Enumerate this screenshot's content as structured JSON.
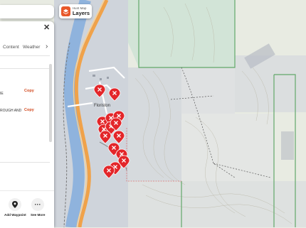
{
  "header": {
    "layers_sublabel": "Hunt Map",
    "layers_label": "Layers"
  },
  "panel": {
    "tabs": [
      "Content",
      "Weather"
    ],
    "rows": [
      {
        "text": "IE",
        "copy": "Copy"
      },
      {
        "text": "ROUGH AND",
        "copy": "Copy"
      }
    ],
    "actions": {
      "add_waypoint": "Add Waypoint",
      "see_more": "See More"
    }
  },
  "map": {
    "town_label": "Floriston",
    "waypoint_color": "#e3262a",
    "icons": [
      "close-icon",
      "chevron-right-icon",
      "pin-icon",
      "more-icon",
      "layers-icon"
    ]
  }
}
